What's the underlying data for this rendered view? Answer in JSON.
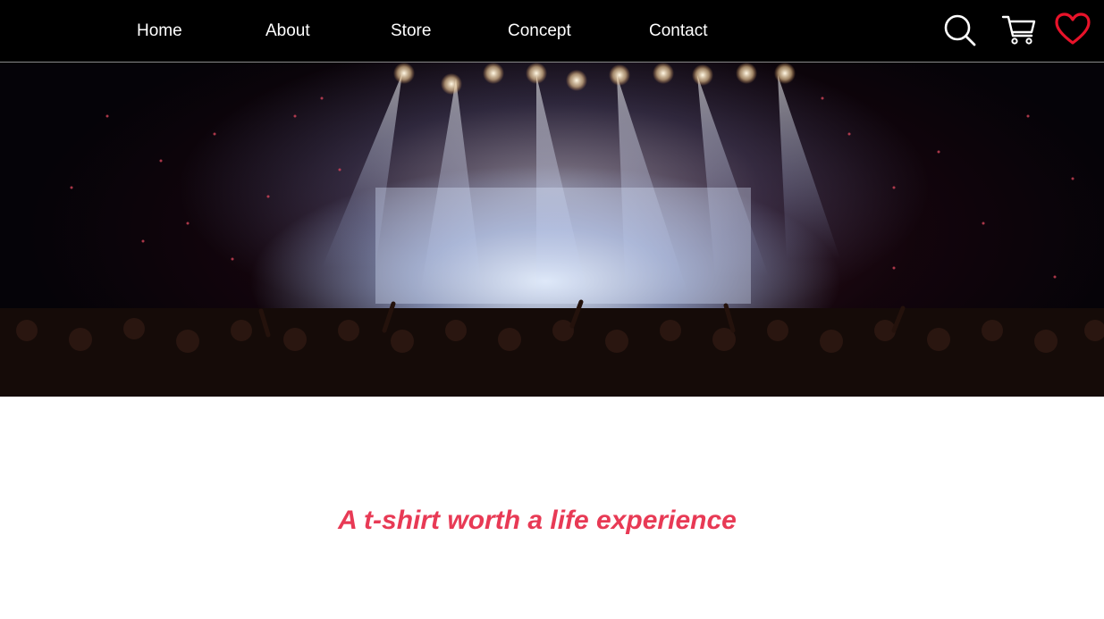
{
  "nav": {
    "links": [
      {
        "label": "Home"
      },
      {
        "label": "About"
      },
      {
        "label": "Store"
      },
      {
        "label": "Concept"
      },
      {
        "label": "Contact"
      }
    ],
    "icons": [
      "search-icon",
      "cart-icon",
      "heart-icon"
    ]
  },
  "hero": {
    "image_alt": "concert-crowd-stage-lights"
  },
  "tagline": "A t-shirt worth a life experience",
  "colors": {
    "nav_bg": "#000000",
    "nav_text": "#ffffff",
    "accent": "#e83a55",
    "heart": "#e8132a"
  }
}
